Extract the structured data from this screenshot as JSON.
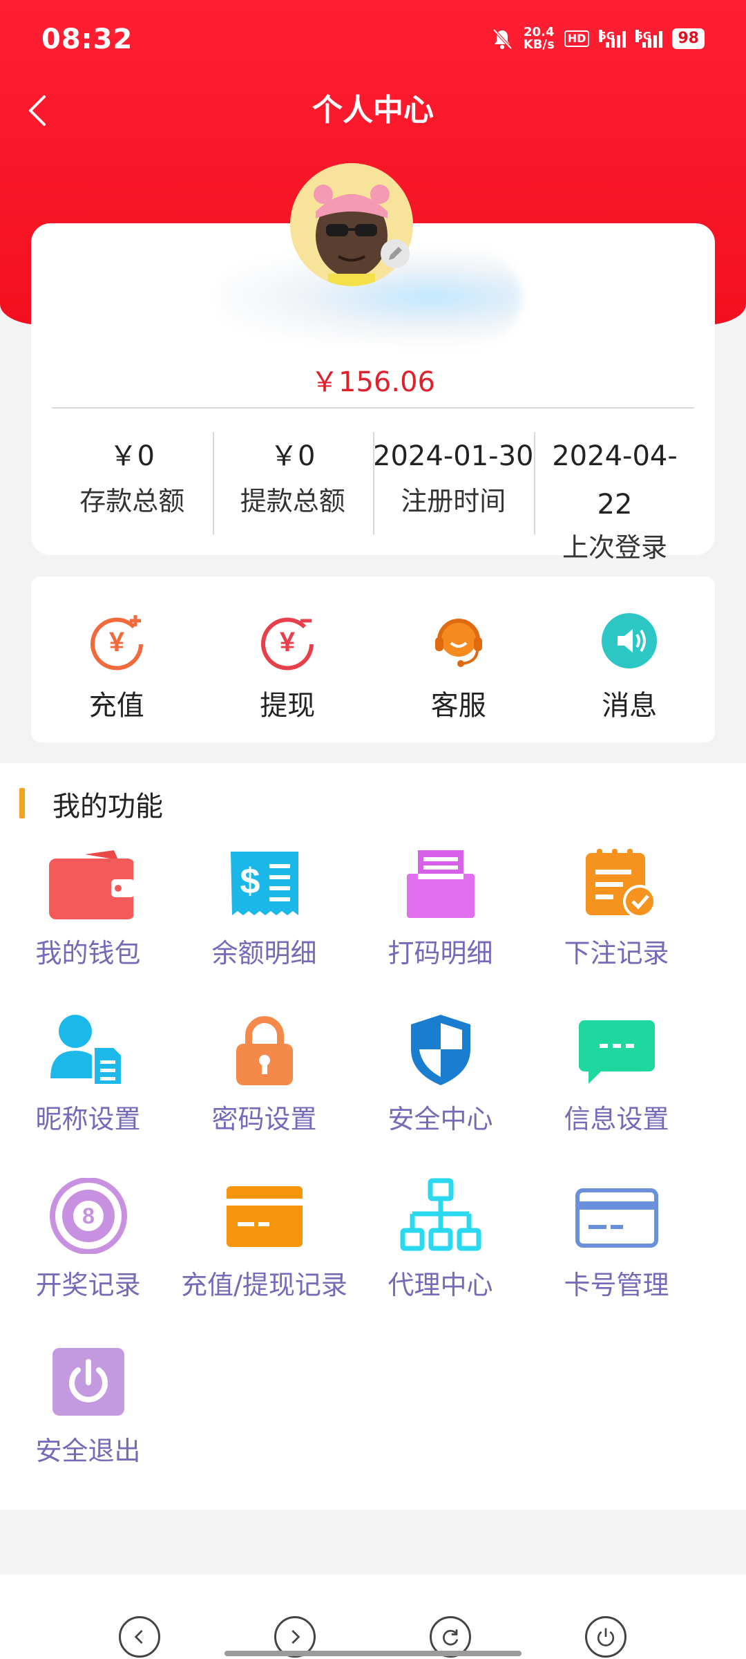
{
  "status_bar": {
    "time": "08:32",
    "net_speed_value": "20.4",
    "net_speed_unit": "KB/s",
    "hd_label": "HD",
    "sig1_label": "5G",
    "sig2_label": "5G",
    "battery": "98"
  },
  "header": {
    "title": "个人中心",
    "back_icon": "chevron-left-icon"
  },
  "profile": {
    "balance": "￥156.06",
    "stats": [
      {
        "value": "￥0",
        "label": "存款总额"
      },
      {
        "value": "￥0",
        "label": "提款总额"
      },
      {
        "value": "2024-01-30",
        "label": "注册时间"
      }
    ],
    "last_login": {
      "value_line1": "2024-04-",
      "value_line2": "22",
      "label": "上次登录"
    }
  },
  "quick_actions": [
    {
      "label": "充值",
      "icon": "yuan-plus-icon",
      "color": "#f06a3c"
    },
    {
      "label": "提现",
      "icon": "yuan-minus-icon",
      "color": "#e8404a"
    },
    {
      "label": "客服",
      "icon": "headset-icon",
      "color": "#f58a1f"
    },
    {
      "label": "消息",
      "icon": "speaker-icon",
      "color": "#2cc6c4"
    }
  ],
  "functions": {
    "title": "我的功能",
    "items": [
      {
        "label": "我的钱包",
        "icon": "wallet-icon"
      },
      {
        "label": "余额明细",
        "icon": "receipt-icon"
      },
      {
        "label": "打码明细",
        "icon": "printer-icon"
      },
      {
        "label": "下注记录",
        "icon": "clipboard-check-icon"
      },
      {
        "label": "昵称设置",
        "icon": "user-doc-icon"
      },
      {
        "label": "密码设置",
        "icon": "lock-icon"
      },
      {
        "label": "安全中心",
        "icon": "shield-icon"
      },
      {
        "label": "信息设置",
        "icon": "chat-bubble-icon"
      },
      {
        "label": "开奖记录",
        "icon": "eight-ball-icon"
      },
      {
        "label": "充值/提现记录",
        "icon": "card-icon"
      },
      {
        "label": "代理中心",
        "icon": "hierarchy-icon"
      },
      {
        "label": "卡号管理",
        "icon": "bank-card-icon"
      },
      {
        "label": "安全退出",
        "icon": "power-icon"
      }
    ]
  },
  "colors": {
    "header_red": "#ff1f33",
    "balance_red": "#e0202b",
    "function_label": "#7868b8",
    "section_accent": "#f5a020"
  },
  "bottom_nav": [
    "back-icon",
    "forward-icon",
    "refresh-icon",
    "power-icon"
  ]
}
